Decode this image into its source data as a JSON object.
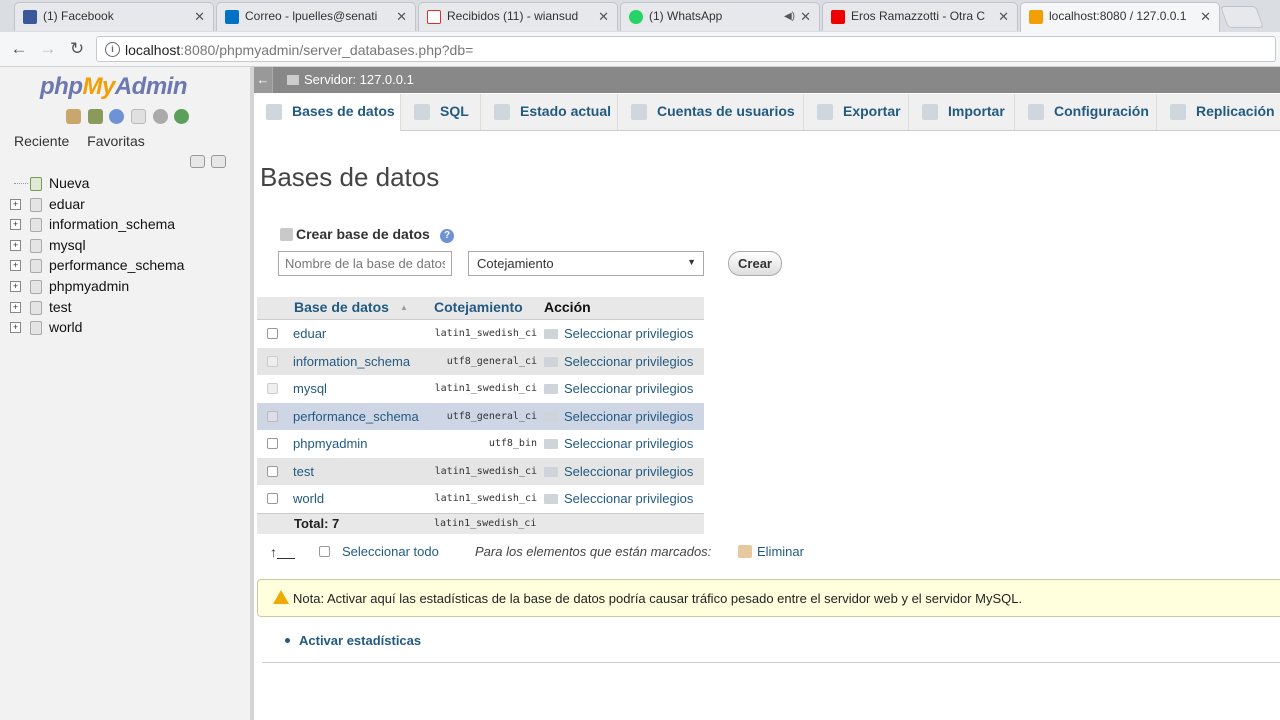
{
  "browser": {
    "tabs": [
      {
        "title": "(1) Facebook",
        "icon": "facebook-icon",
        "color": "#3b5998"
      },
      {
        "title": "Correo - lpuelles@senati",
        "icon": "outlook-icon",
        "color": "#0072c6"
      },
      {
        "title": "Recibidos (11) - wiansud",
        "icon": "gmail-icon",
        "color": "#d93025"
      },
      {
        "title": "(1) WhatsApp",
        "icon": "whatsapp-icon",
        "color": "#25d366"
      },
      {
        "title": "Eros Ramazzotti - Otra C",
        "icon": "youtube-icon",
        "color": "#e00"
      },
      {
        "title": "localhost:8080 / 127.0.0.1",
        "icon": "phpmyadmin-icon",
        "color": "#f29f05"
      }
    ],
    "url_host": "localhost",
    "url_rest": ":8080/phpmyadmin/server_databases.php?db="
  },
  "nav": {
    "logo_php": "php",
    "logo_my": "My",
    "logo_admin": "Admin",
    "recent": "Reciente",
    "favorites": "Favoritas",
    "tree": [
      "Nueva",
      "eduar",
      "information_schema",
      "mysql",
      "performance_schema",
      "phpmyadmin",
      "test",
      "world"
    ]
  },
  "server": {
    "label": "Servidor: 127.0.0.1"
  },
  "menu": [
    "Bases de datos",
    "SQL",
    "Estado actual",
    "Cuentas de usuarios",
    "Exportar",
    "Importar",
    "Configuración",
    "Replicación"
  ],
  "page": {
    "title": "Bases de datos",
    "create_label": "Crear base de datos",
    "name_placeholder": "Nombre de la base de datos",
    "collation_placeholder": "Cotejamiento",
    "create_button": "Crear"
  },
  "table": {
    "headers": [
      "Base de datos",
      "Cotejamiento",
      "Acción"
    ],
    "rows": [
      {
        "name": "eduar",
        "collation": "latin1_swedish_ci",
        "action": "Seleccionar privilegios"
      },
      {
        "name": "information_schema",
        "collation": "utf8_general_ci",
        "action": "Seleccionar privilegios"
      },
      {
        "name": "mysql",
        "collation": "latin1_swedish_ci",
        "action": "Seleccionar privilegios"
      },
      {
        "name": "performance_schema",
        "collation": "utf8_general_ci",
        "action": "Seleccionar privilegios"
      },
      {
        "name": "phpmyadmin",
        "collation": "utf8_bin",
        "action": "Seleccionar privilegios"
      },
      {
        "name": "test",
        "collation": "latin1_swedish_ci",
        "action": "Seleccionar privilegios"
      },
      {
        "name": "world",
        "collation": "latin1_swedish_ci",
        "action": "Seleccionar privilegios"
      }
    ],
    "total": "Total: 7",
    "total_collation": "latin1_swedish_ci"
  },
  "bulk": {
    "select_all": "Seleccionar todo",
    "with_selected": "Para los elementos que están marcados:",
    "delete": "Eliminar"
  },
  "notice": "Nota: Activar aquí las estadísticas de la base de datos podría causar tráfico pesado entre el servidor web y el servidor MySQL.",
  "enable_stats": "Activar estadísticas"
}
